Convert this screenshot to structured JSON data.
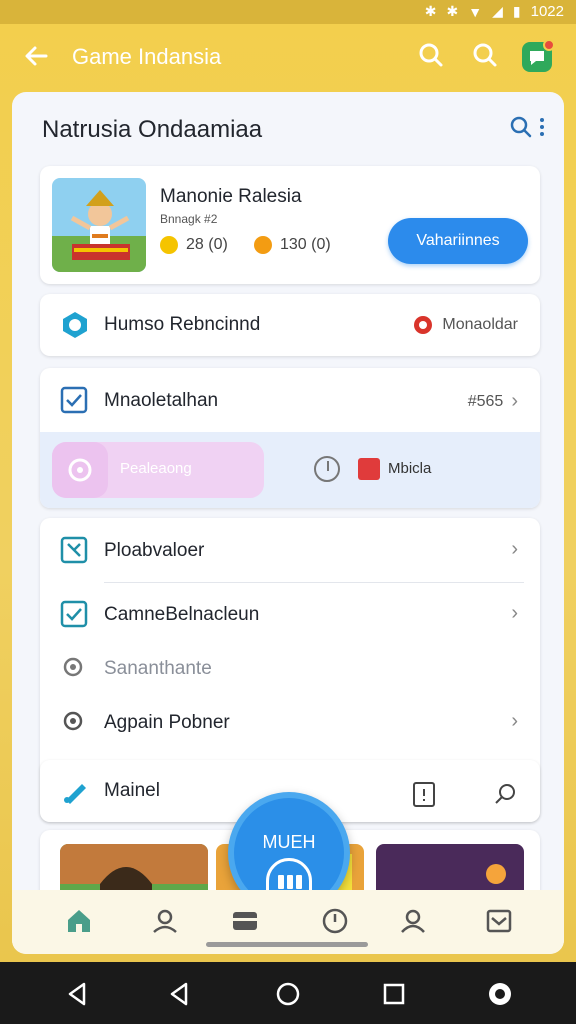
{
  "status_bar": {
    "time": "1022"
  },
  "app_bar": {
    "title": "Game Indansia"
  },
  "sheet": {
    "title": "Natrusia Ondaamiaa"
  },
  "game_card": {
    "title": "Manonie Ralesia",
    "subtitle": "Bnnagk #2",
    "stat1": "28 (0)",
    "stat2": "130 (0)",
    "button": "Vahariinnes"
  },
  "row1": {
    "label": "Humso Rebncinnd",
    "right": "Monaoldar"
  },
  "combo": {
    "label": "Mnaoletalhan",
    "right": "#565",
    "pill_label": "Pealeaong",
    "right_label": "Mbicla"
  },
  "list": {
    "items": [
      {
        "label": "Ploabvaloer"
      },
      {
        "label": "CamneBelnacleun"
      },
      {
        "label": "Sananthante"
      },
      {
        "label": "Agpain Pobner"
      }
    ]
  },
  "map_row": {
    "label": "Mainel"
  },
  "fab": {
    "label": "MUEH"
  },
  "colors": {
    "accent": "#2c8bec",
    "background": "#f3cf4c",
    "sheet": "#f4f6fb"
  }
}
